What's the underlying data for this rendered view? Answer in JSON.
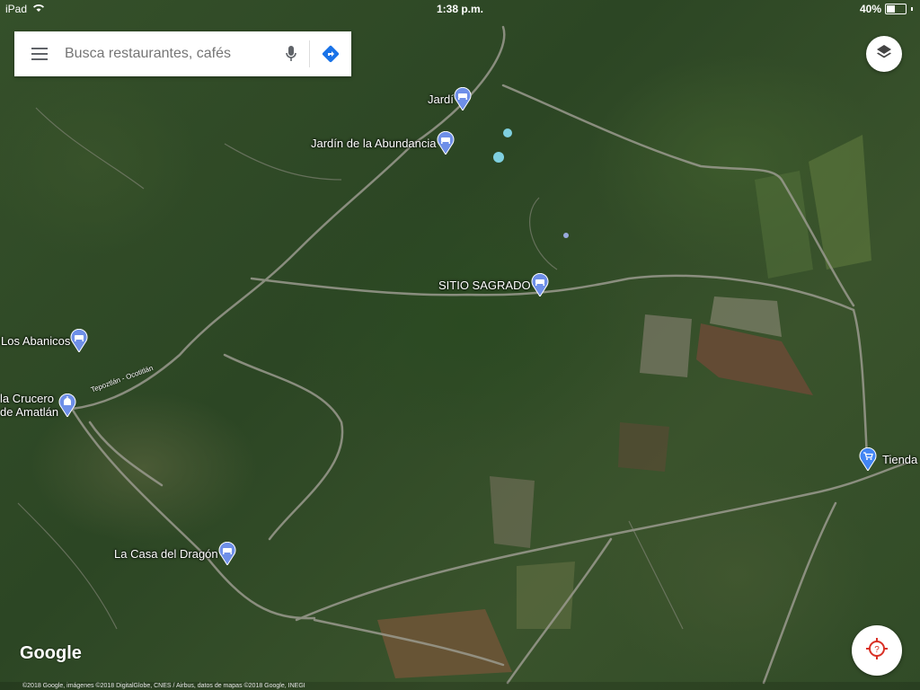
{
  "status_bar": {
    "device": "iPad",
    "time": "1:38 p.m.",
    "battery": "40%",
    "battery_level": 0.4
  },
  "search": {
    "placeholder": "Busca restaurantes, cafés",
    "icons": {
      "menu": "menu-icon",
      "mic": "microphone-icon",
      "directions": "directions-icon"
    }
  },
  "controls": {
    "layers_icon": "layers-icon",
    "help_icon": "help-icon"
  },
  "map": {
    "logo": "Google",
    "attribution": "©2018 Google, imágenes ©2018 DigitalGlobe, CNES / Airbus, datos de mapas ©2018 Google, INEGI",
    "road_label": "Tepoztlán - Ocotitlán",
    "places": [
      {
        "name": "Jardí",
        "type": "hotel"
      },
      {
        "name": "Jardín de la Abundancia",
        "type": "hotel"
      },
      {
        "name": "SITIO SAGRADO",
        "type": "hotel"
      },
      {
        "name": "Los Abanicos",
        "type": "hotel"
      },
      {
        "name": "la Crucero",
        "name2": "de Amatlán",
        "type": "mosque"
      },
      {
        "name": "Tienda",
        "type": "shop"
      },
      {
        "name": "La Casa del Dragón",
        "type": "hotel"
      }
    ]
  },
  "colors": {
    "pin": "#4285f4",
    "help_red": "#d93025"
  }
}
